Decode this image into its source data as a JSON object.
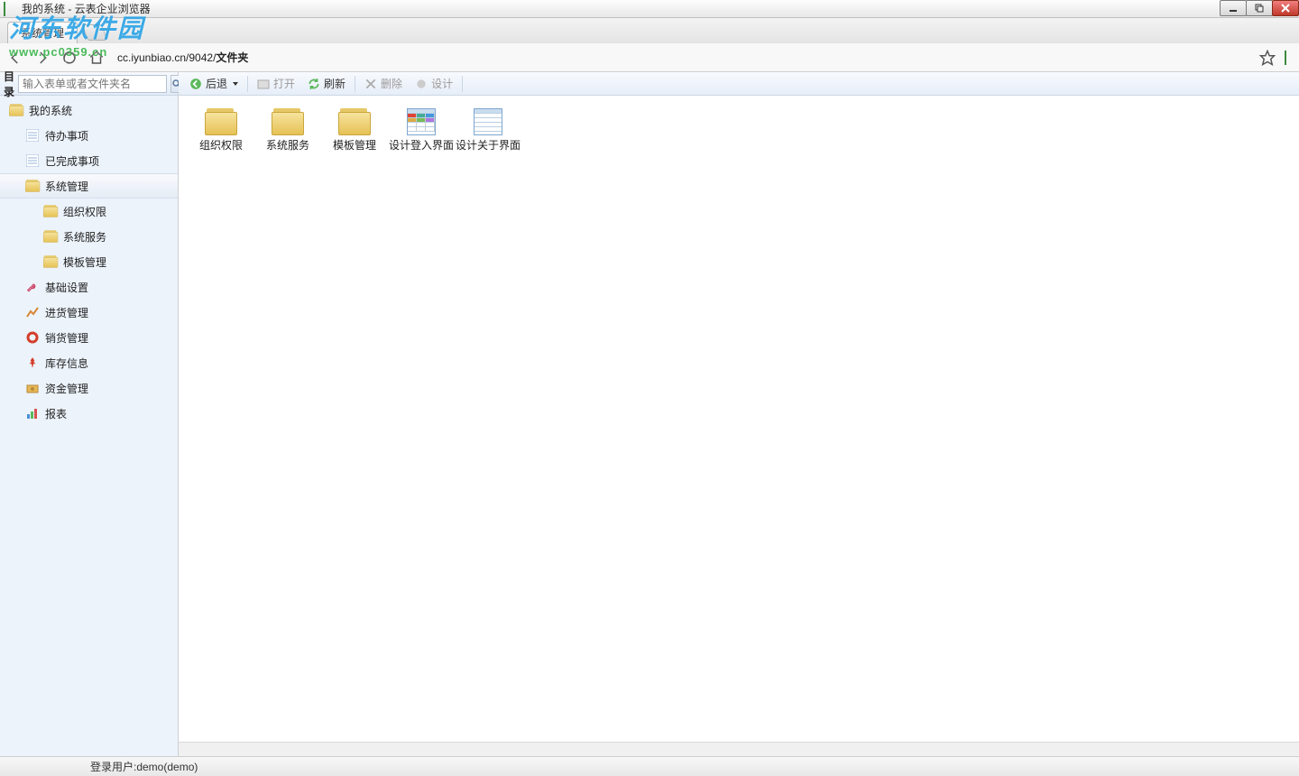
{
  "window": {
    "title": "我的系统 - 云表企业浏览器"
  },
  "watermark": {
    "big": "河东软件园",
    "sub": "www.pc0359.cn"
  },
  "tab": {
    "label": "系统管理"
  },
  "address": {
    "url_plain": "cc.iyunbiao.cn/9042/",
    "url_bold": "文件夹"
  },
  "sidebar": {
    "head_label": "目录",
    "search_placeholder": "输入表单或者文件夹名",
    "root": "我的系统",
    "todo": "待办事项",
    "done": "已完成事项",
    "sysmgr": "系统管理",
    "orgperm": "组织权限",
    "sysservice": "系统服务",
    "tplmgr": "模板管理",
    "basecfg": "基础设置",
    "purchase": "进货管理",
    "sales": "销货管理",
    "stock": "库存信息",
    "fund": "资金管理",
    "report": "报表"
  },
  "toolbar": {
    "back": "后退",
    "open": "打开",
    "refresh": "刷新",
    "delete": "删除",
    "design": "设计"
  },
  "items": {
    "i0": "组织权限",
    "i1": "系统服务",
    "i2": "模板管理",
    "i3": "设计登入界面",
    "i4": "设计关于界面"
  },
  "status": {
    "user": "登录用户:demo(demo)"
  }
}
